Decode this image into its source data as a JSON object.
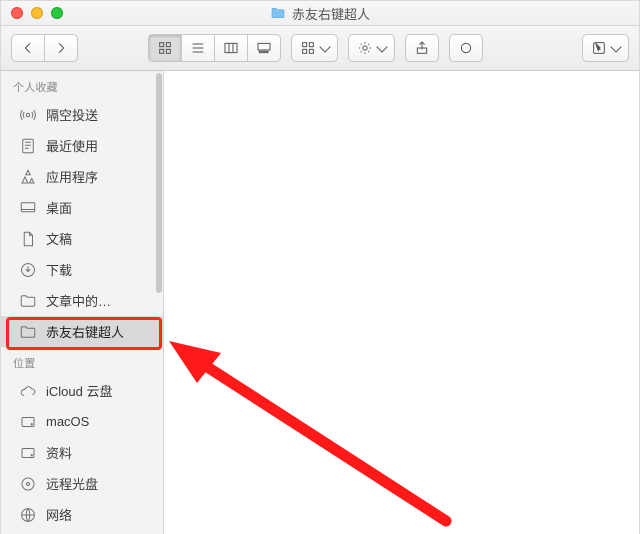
{
  "titlebar": {
    "title": "赤友右键超人"
  },
  "toolbar": {},
  "sidebar": {
    "section_favorites": "个人收藏",
    "section_locations": "位置",
    "favorites": [
      {
        "icon": "airdrop",
        "label": "隔空投送"
      },
      {
        "icon": "recents",
        "label": "最近使用"
      },
      {
        "icon": "apps",
        "label": "应用程序"
      },
      {
        "icon": "desktop",
        "label": "桌面"
      },
      {
        "icon": "documents",
        "label": "文稿"
      },
      {
        "icon": "downloads",
        "label": "下载"
      },
      {
        "icon": "folder",
        "label": "文章中的…"
      },
      {
        "icon": "folder",
        "label": "赤友右键超人"
      }
    ],
    "locations": [
      {
        "icon": "cloud",
        "label": "iCloud 云盘"
      },
      {
        "icon": "disk",
        "label": "macOS"
      },
      {
        "icon": "data",
        "label": "资料"
      },
      {
        "icon": "optical",
        "label": "远程光盘"
      },
      {
        "icon": "network",
        "label": "网络"
      }
    ]
  }
}
